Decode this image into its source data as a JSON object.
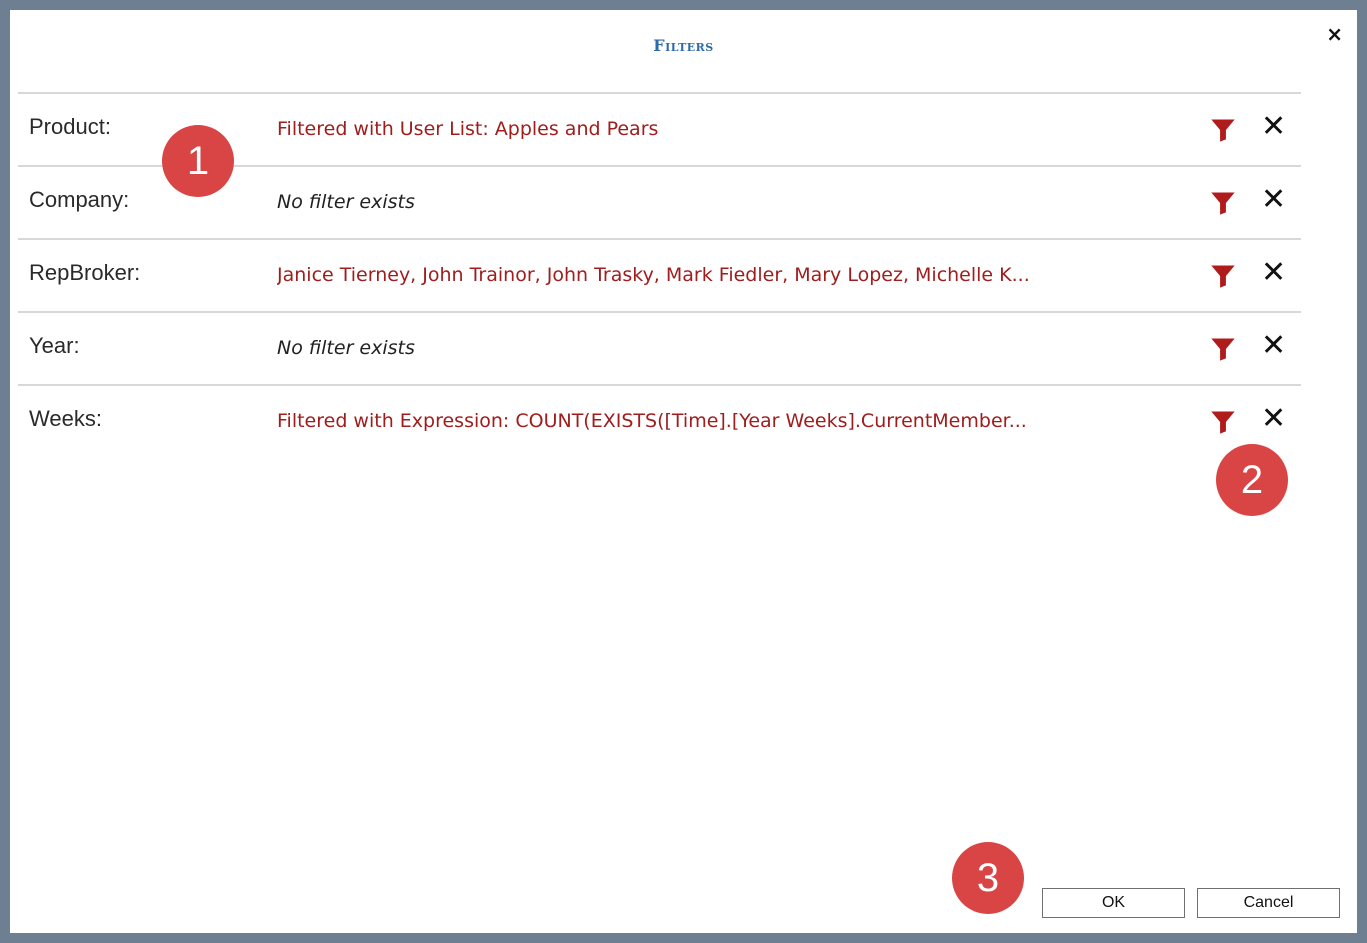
{
  "dialog": {
    "title": "Filters",
    "close_label": "×"
  },
  "rows": [
    {
      "label": "Product:",
      "value": "Filtered with User List: Apples and Pears",
      "filtered": true
    },
    {
      "label": "Company:",
      "value": "No filter exists",
      "filtered": false
    },
    {
      "label": "RepBroker:",
      "value": "Janice Tierney, John Trainor, John Trasky, Mark Fiedler, Mary Lopez, Michelle K...",
      "filtered": true
    },
    {
      "label": "Year:",
      "value": "No filter exists",
      "filtered": false
    },
    {
      "label": "Weeks:",
      "value": "Filtered with Expression: COUNT(EXISTS([Time].[Year Weeks].CurrentMember...",
      "filtered": true
    }
  ],
  "row_icons": {
    "funnel": "funnel-icon",
    "remove": "close-icon",
    "remove_glyph": "✕"
  },
  "badges": [
    "1",
    "2",
    "3"
  ],
  "buttons": {
    "ok_label": "OK",
    "cancel_label": "Cancel"
  },
  "colors": {
    "filtered_text": "#a01d1d",
    "funnel": "#b01c1c",
    "badge": "#d94444",
    "title": "#2f6aa8"
  }
}
